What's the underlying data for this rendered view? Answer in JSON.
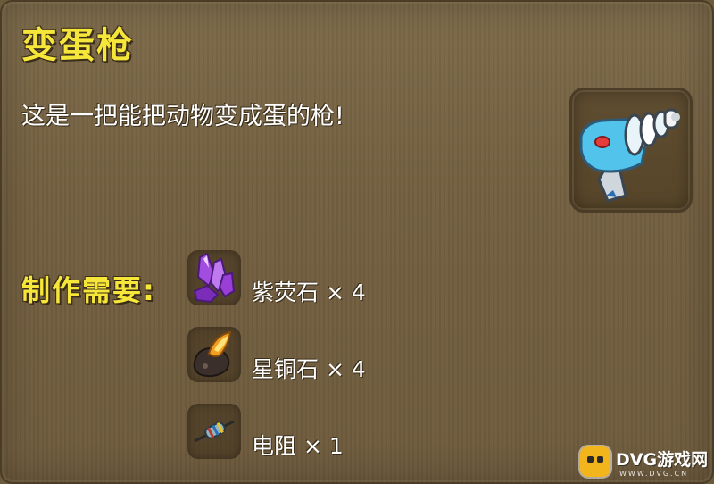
{
  "item": {
    "name": "变蛋枪",
    "description": "这是一把能把动物变成蛋的枪!",
    "icon": "egg-gun-icon"
  },
  "recipe": {
    "label": "制作需要:",
    "materials": [
      {
        "name": "紫荧石",
        "quantity": "× 4",
        "icon": "purple-crystal-icon"
      },
      {
        "name": "星铜石",
        "quantity": "× 4",
        "icon": "star-copper-ore-icon"
      },
      {
        "name": "电阻",
        "quantity": "× 1",
        "icon": "resistor-icon"
      }
    ]
  },
  "watermark": {
    "text": "DVG游戏网",
    "sub": "WWW.DVG.CN"
  },
  "colors": {
    "title": "#f7e63a",
    "panel": "#735f40",
    "text": "#ffffff"
  }
}
